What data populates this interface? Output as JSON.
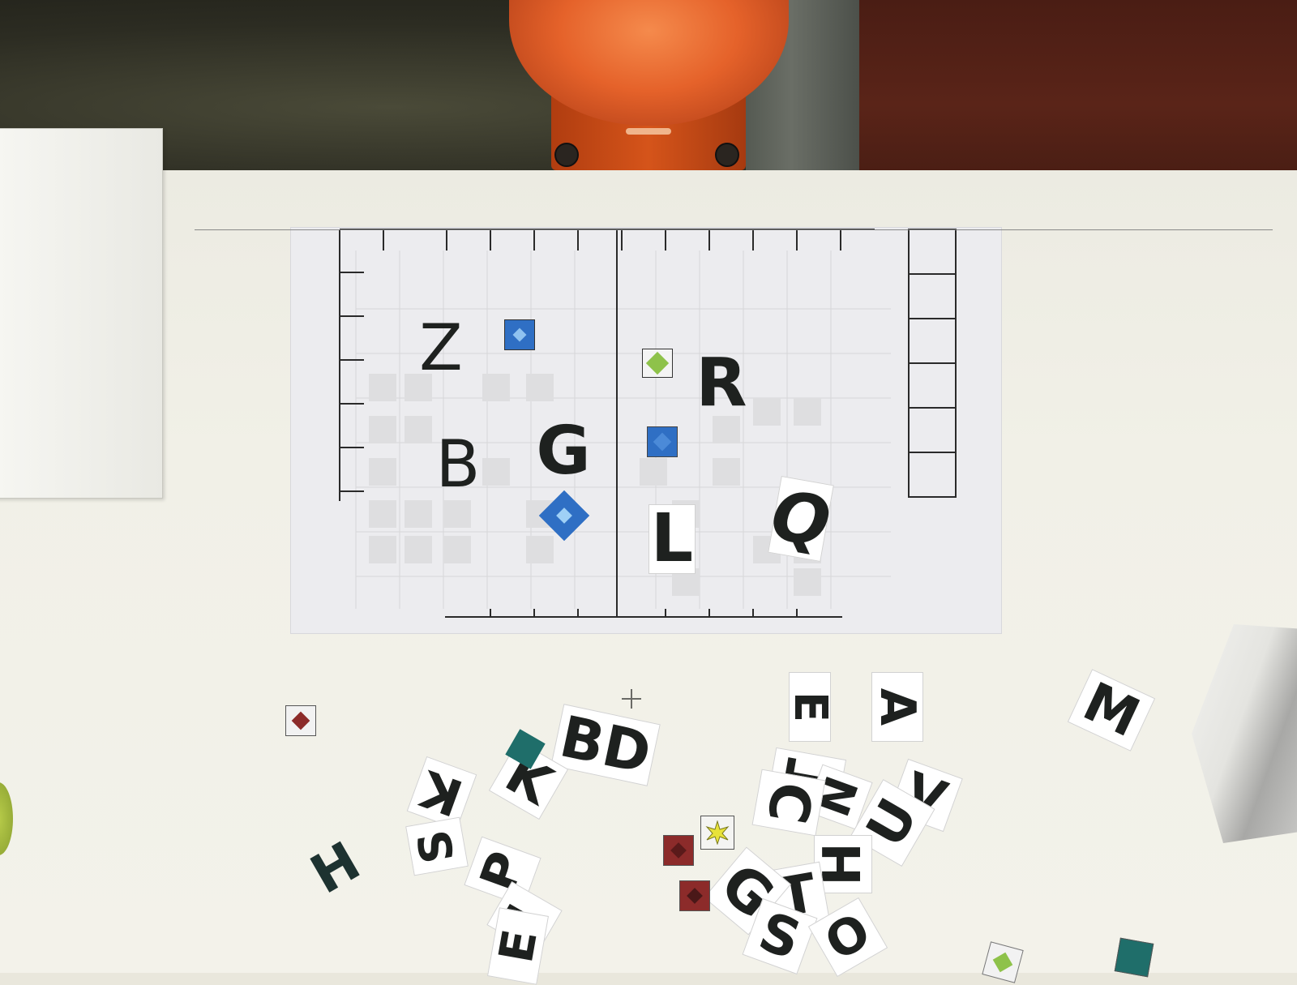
{
  "scene": {
    "colors": {
      "robot_orange": "#e5622a",
      "table_white": "#f1f0e7",
      "letter_black": "#1e211f",
      "tile_blue": "#2f6fc4",
      "tile_green": "#8ec24a",
      "tile_red": "#8c2b2a",
      "tile_yellow": "#e8e23a",
      "tile_teal": "#1f6e6a"
    },
    "robot": {
      "icon": "robot-arm-icon"
    },
    "grid_board": {
      "letters": [
        {
          "id": "z",
          "char": "Z"
        },
        {
          "id": "b",
          "char": "B"
        },
        {
          "id": "g",
          "char": "G"
        },
        {
          "id": "r",
          "char": "R"
        },
        {
          "id": "l",
          "char": "L"
        },
        {
          "id": "q",
          "char": "Q"
        }
      ],
      "tiles": [
        {
          "id": "blue-star-top",
          "color": "#2f6fc4",
          "icon": "star-icon"
        },
        {
          "id": "green-diamond",
          "color": "#8ec24a",
          "icon": "diamond-icon"
        },
        {
          "id": "blue-square",
          "color": "#2f6fc4",
          "icon": "diamond-icon"
        },
        {
          "id": "blue-diamond-bottom",
          "color": "#2f6fc4",
          "icon": "star-icon"
        }
      ]
    },
    "scattered": {
      "letters": [
        {
          "id": "e",
          "char": "E"
        },
        {
          "id": "a",
          "char": "A"
        },
        {
          "id": "m",
          "char": "M"
        },
        {
          "id": "bd",
          "char": "BD"
        },
        {
          "id": "k1",
          "char": "K"
        },
        {
          "id": "k2",
          "char": "K"
        },
        {
          "id": "h",
          "char": "H"
        },
        {
          "id": "t1",
          "char": "T"
        },
        {
          "id": "n",
          "char": "N"
        },
        {
          "id": "z2",
          "char": "Z"
        },
        {
          "id": "v",
          "char": "V"
        },
        {
          "id": "u",
          "char": "U"
        },
        {
          "id": "c",
          "char": "C"
        },
        {
          "id": "h2",
          "char": "H"
        },
        {
          "id": "t2",
          "char": "T"
        },
        {
          "id": "g2",
          "char": "G"
        },
        {
          "id": "s1",
          "char": "S"
        },
        {
          "id": "s2",
          "char": "S"
        },
        {
          "id": "p",
          "char": "P"
        },
        {
          "id": "i",
          "char": "I"
        },
        {
          "id": "e2",
          "char": "E"
        },
        {
          "id": "o",
          "char": "O"
        }
      ],
      "tiles": [
        {
          "id": "red-1",
          "color": "#8c2b2a"
        },
        {
          "id": "red-2",
          "color": "#8c2b2a"
        },
        {
          "id": "red-3",
          "color": "#8c2b2a"
        },
        {
          "id": "yellow-star",
          "color": "#e8e23a"
        },
        {
          "id": "teal-1",
          "color": "#1f6e6a"
        },
        {
          "id": "green-2",
          "color": "#8ec24a"
        },
        {
          "id": "teal-2",
          "color": "#1f6e6a"
        }
      ]
    }
  }
}
